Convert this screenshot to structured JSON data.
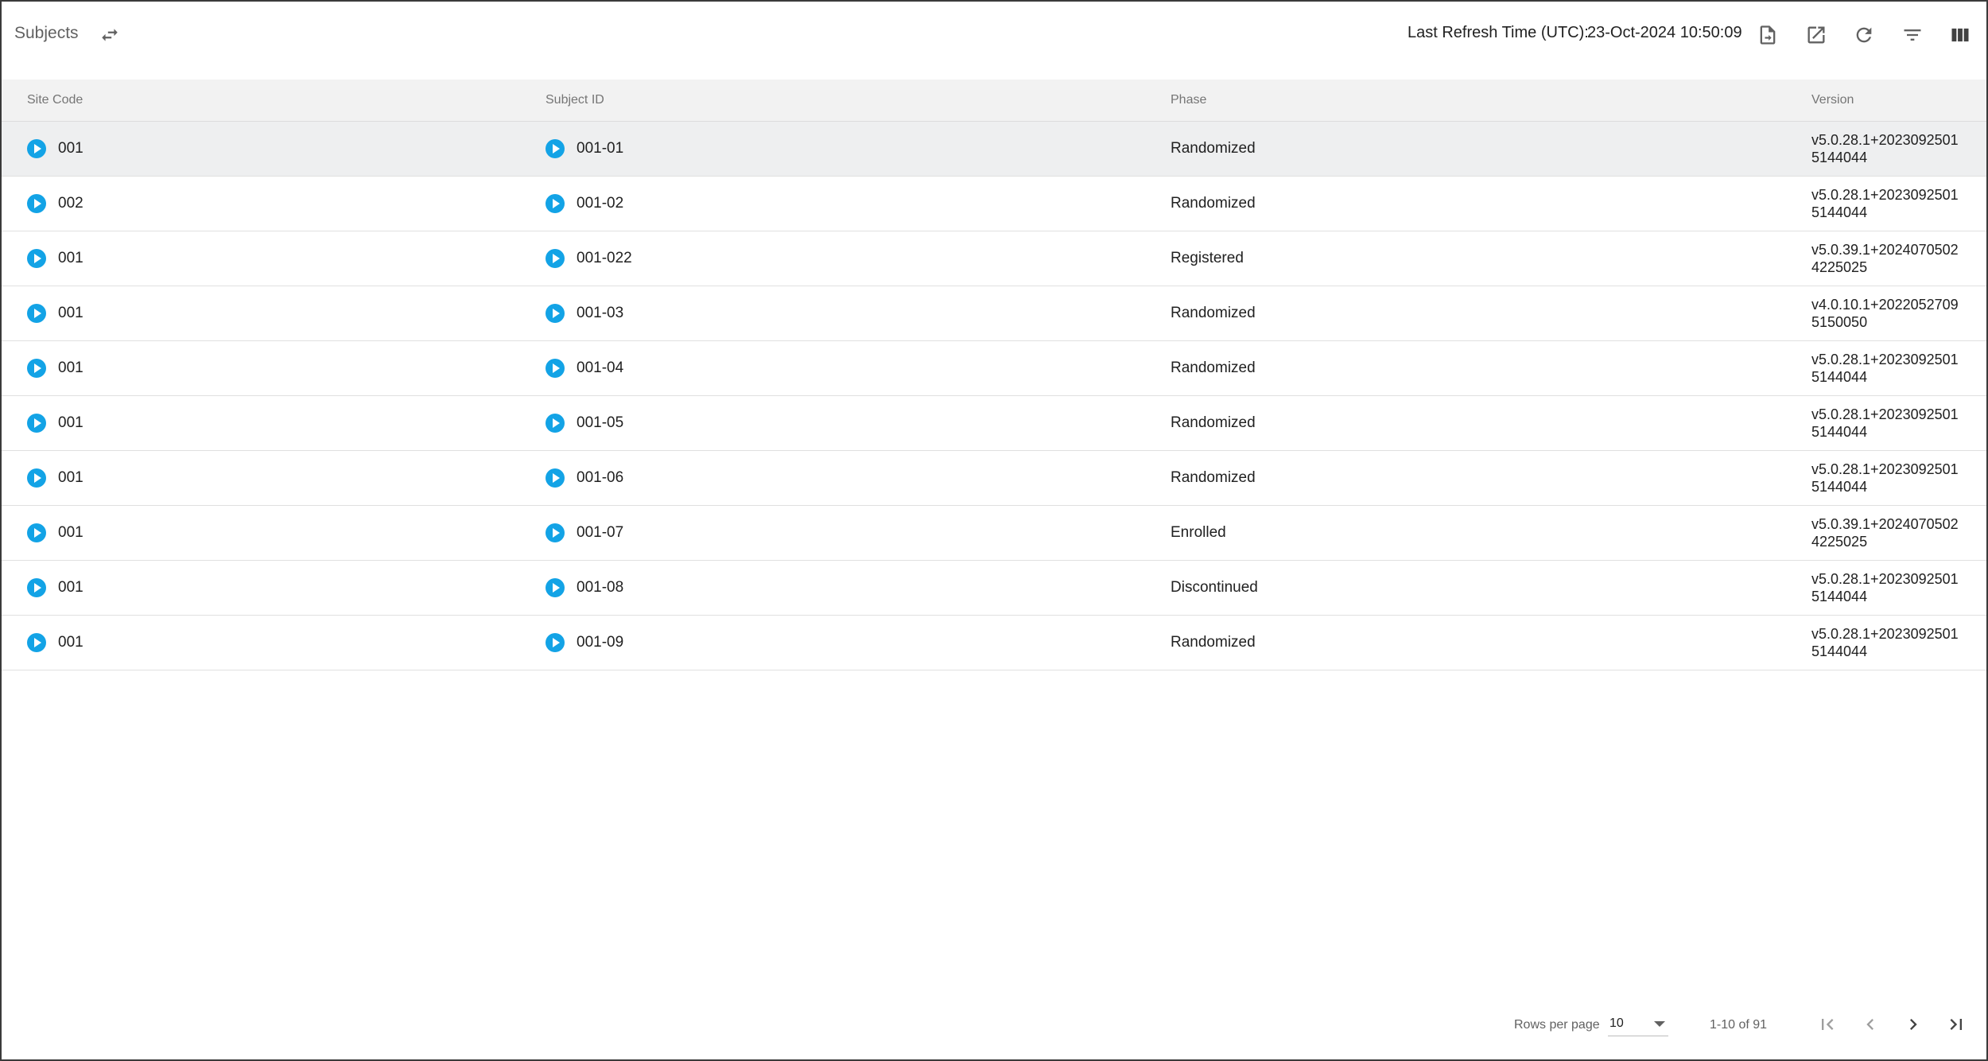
{
  "header": {
    "title": "Subjects",
    "last_refresh_label": "Last Refresh Time (UTC):",
    "last_refresh_value": "23-Oct-2024 10:50:09"
  },
  "toolbar_icons": [
    "export-file-icon",
    "open-external-icon",
    "refresh-icon",
    "filter-icon",
    "columns-icon"
  ],
  "table": {
    "columns": [
      "Site Code",
      "Subject ID",
      "Phase",
      "Version"
    ],
    "rows": [
      {
        "site": "001",
        "subject": "001-01",
        "phase": "Randomized",
        "version": "v5.0.28.1+20230925015144044"
      },
      {
        "site": "002",
        "subject": "001-02",
        "phase": "Randomized",
        "version": "v5.0.28.1+20230925015144044"
      },
      {
        "site": "001",
        "subject": "001-022",
        "phase": "Registered",
        "version": "v5.0.39.1+20240705024225025"
      },
      {
        "site": "001",
        "subject": "001-03",
        "phase": "Randomized",
        "version": "v4.0.10.1+20220527095150050"
      },
      {
        "site": "001",
        "subject": "001-04",
        "phase": "Randomized",
        "version": "v5.0.28.1+20230925015144044"
      },
      {
        "site": "001",
        "subject": "001-05",
        "phase": "Randomized",
        "version": "v5.0.28.1+20230925015144044"
      },
      {
        "site": "001",
        "subject": "001-06",
        "phase": "Randomized",
        "version": "v5.0.28.1+20230925015144044"
      },
      {
        "site": "001",
        "subject": "001-07",
        "phase": "Enrolled",
        "version": "v5.0.39.1+20240705024225025"
      },
      {
        "site": "001",
        "subject": "001-08",
        "phase": "Discontinued",
        "version": "v5.0.28.1+20230925015144044"
      },
      {
        "site": "001",
        "subject": "001-09",
        "phase": "Randomized",
        "version": "v5.0.28.1+20230925015144044"
      }
    ]
  },
  "pagination": {
    "rows_per_page_label": "Rows per page",
    "rows_per_page_value": "10",
    "range_text": "1-10 of 91"
  },
  "colors": {
    "accent": "#13a3e6",
    "header_bg": "#f2f2f2",
    "selected_row_bg": "#eeeff0"
  }
}
